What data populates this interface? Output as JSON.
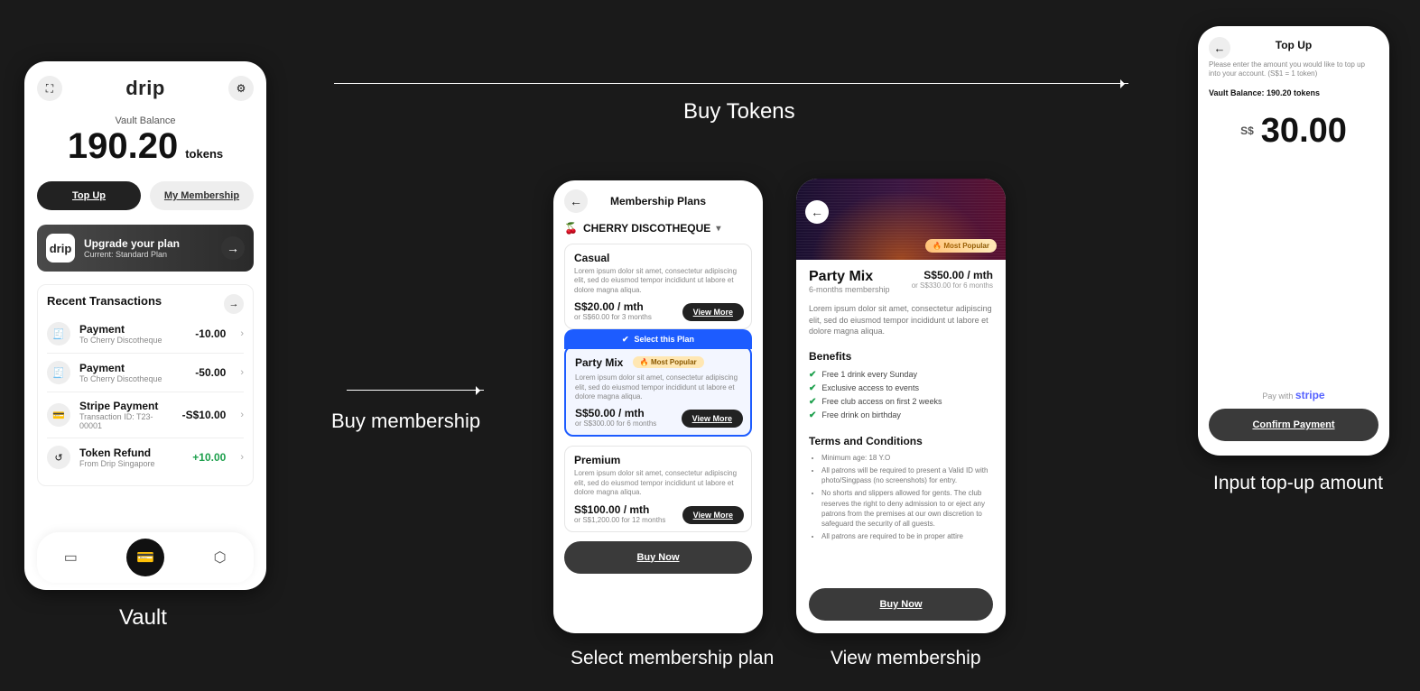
{
  "flow": {
    "vault_label": "Vault",
    "buy_tokens": "Buy Tokens",
    "buy_membership": "Buy membership",
    "select_plan": "Select membership plan",
    "view_membership": "View membership",
    "input_topup": "Input top-up amount"
  },
  "vault": {
    "logo": "drip",
    "balance_label": "Vault Balance",
    "balance_amount": "190.20",
    "balance_unit": "tokens",
    "topup_label": "Top Up",
    "membership_label": "My Membership",
    "upgrade_title": "Upgrade your plan",
    "upgrade_sub": "Current: Standard Plan",
    "recent_header": "Recent Transactions",
    "tx": [
      {
        "name": "Payment",
        "sub": "To Cherry Discotheque",
        "amt": "-10.00",
        "positive": false
      },
      {
        "name": "Payment",
        "sub": "To Cherry Discotheque",
        "amt": "-50.00",
        "positive": false
      },
      {
        "name": "Stripe Payment",
        "sub": "Transaction ID: T23-00001",
        "amt": "-S$10.00",
        "positive": false
      },
      {
        "name": "Token Refund",
        "sub": "From Drip Singapore",
        "amt": "+10.00",
        "positive": true
      }
    ]
  },
  "plans": {
    "title": "Membership Plans",
    "venue": "CHERRY DISCOTHEQUE",
    "venue_icon": "🍒",
    "lorem": "Lorem ipsum dolor sit amet, consectetur adipiscing elit, sed do eiusmod tempor incididunt ut labore et dolore magna aliqua.",
    "select_label": "Select this Plan",
    "popular_label": "🔥 Most Popular",
    "view_more": "View More",
    "buy_now": "Buy Now",
    "cards": [
      {
        "name": "Casual",
        "price": "S$20.00 / mth",
        "alt": "or S$60.00 for 3 months"
      },
      {
        "name": "Party Mix",
        "price": "S$50.00 / mth",
        "alt": "or S$300.00 for 6 months"
      },
      {
        "name": "Premium",
        "price": "S$100.00 / mth",
        "alt": "or S$1,200.00 for 12 months"
      }
    ]
  },
  "view": {
    "popular_label": "🔥 Most Popular",
    "name": "Party Mix",
    "sub": "6-months membership",
    "price": "S$50.00 / mth",
    "alt": "or S$330.00 for 6 months",
    "desc": "Lorem ipsum dolor sit amet, consectetur adipiscing elit, sed do eiusmod tempor incididunt ut labore et dolore magna aliqua.",
    "benefits_title": "Benefits",
    "benefits": [
      "Free 1 drink every Sunday",
      "Exclusive access to events",
      "Free club access on first 2 weeks",
      "Free drink on birthday"
    ],
    "terms_title": "Terms and Conditions",
    "terms": [
      "Minimum age: 18 Y.O",
      "All patrons will be required to present a Valid ID with photo/Singpass (no screenshots) for entry.",
      "No shorts and slippers allowed for gents. The club reserves the right to deny admission to or eject any patrons from the premises at our own discretion to safeguard the security of all guests.",
      "All patrons are required to be in proper attire"
    ],
    "buy_now": "Buy Now"
  },
  "topup": {
    "title": "Top Up",
    "hint": "Please enter the amount you would like to top up into your account. (S$1 = 1 token)",
    "vault_balance": "Vault Balance: 190.20 tokens",
    "currency": "S$",
    "amount": "30.00",
    "paywith": "Pay with",
    "stripe": "stripe",
    "confirm": "Confirm Payment"
  }
}
